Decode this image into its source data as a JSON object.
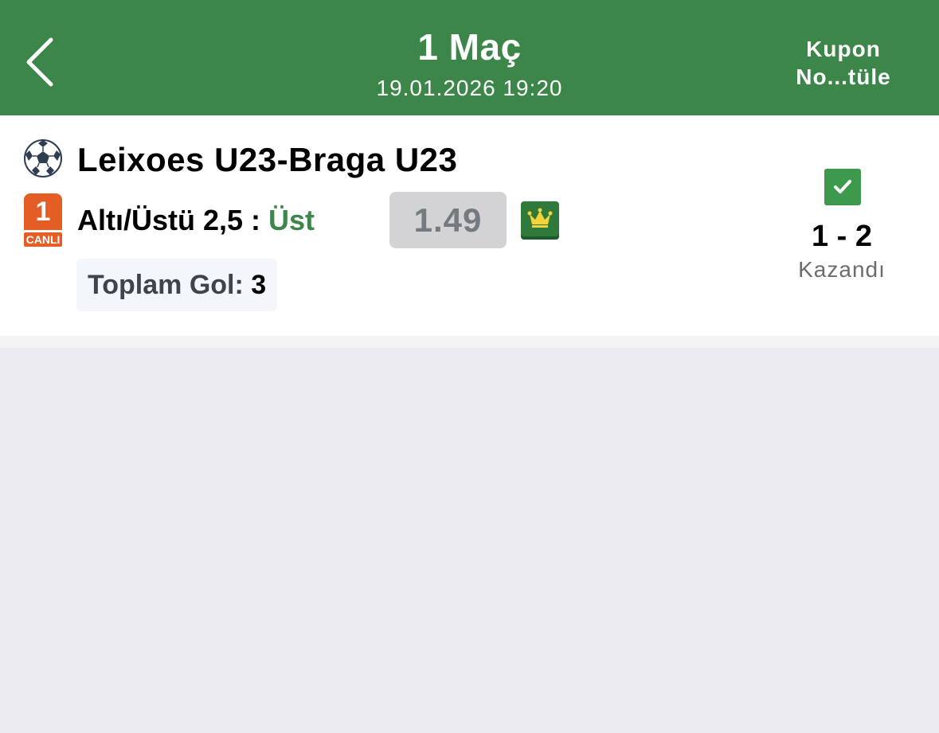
{
  "header": {
    "back_icon": "chevron-left-icon",
    "title": "1 Maç",
    "subtitle": "19.01.2026 19:20",
    "kupon_label_line1": "Kupon",
    "kupon_label_line2": "No...tüle",
    "background_color": "#3b8648"
  },
  "match": {
    "sport_icon": "soccer-ball-icon",
    "title": "Leixoes U23-Braga U23",
    "live_badge_number": "1",
    "live_badge_label": "CANLI",
    "bet_market": "Altı/Üstü 2,5 : ",
    "bet_pick": "Üst",
    "odds": "1.49",
    "crown_icon": "crown-icon",
    "total_goals_label": "Toplam Gol: ",
    "total_goals_value": "3",
    "result_icon": "checkbox-checked-icon",
    "score": "1 - 2",
    "status": "Kazandı"
  },
  "colors": {
    "accent_green": "#3b8648",
    "live_orange": "#e35d24",
    "page_background": "#ebebf0"
  }
}
